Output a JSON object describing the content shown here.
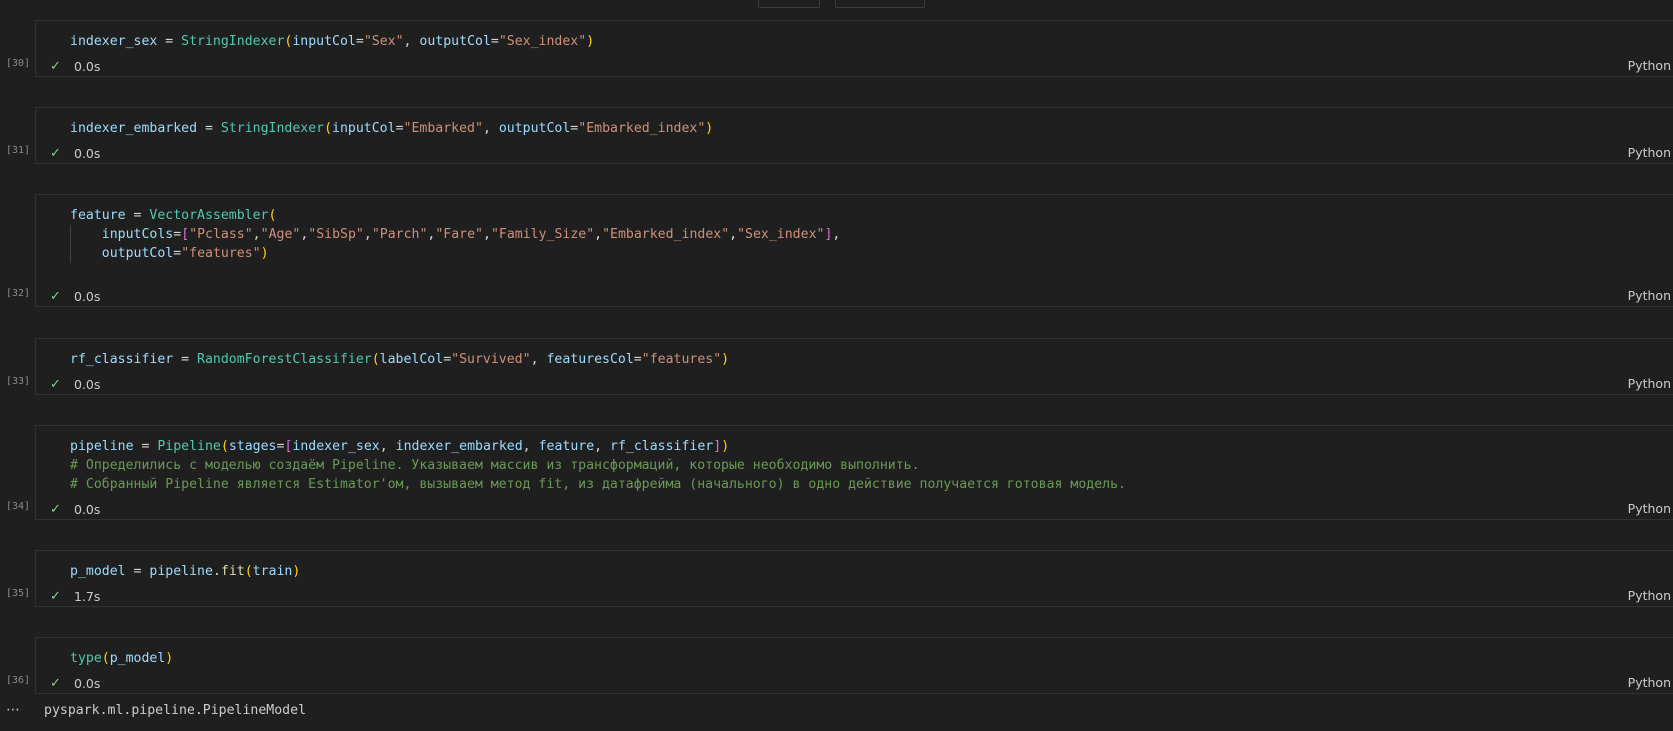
{
  "cells": [
    {
      "exec_count": "[30]",
      "time": "0.0s",
      "language": "Python",
      "lines": [
        [
          [
            "indexer_sex",
            "v"
          ],
          [
            " = ",
            "o"
          ],
          [
            "StringIndexer",
            "c"
          ],
          [
            "(",
            "b1"
          ],
          [
            "inputCol",
            "v"
          ],
          [
            "=",
            "o"
          ],
          [
            "\"Sex\"",
            "s"
          ],
          [
            ", ",
            "o"
          ],
          [
            "outputCol",
            "v"
          ],
          [
            "=",
            "o"
          ],
          [
            "\"Sex_index\"",
            "s"
          ],
          [
            ")",
            "b1"
          ]
        ]
      ]
    },
    {
      "exec_count": "[31]",
      "time": "0.0s",
      "language": "Python",
      "lines": [
        [
          [
            "indexer_embarked",
            "v"
          ],
          [
            " = ",
            "o"
          ],
          [
            "StringIndexer",
            "c"
          ],
          [
            "(",
            "b1"
          ],
          [
            "inputCol",
            "v"
          ],
          [
            "=",
            "o"
          ],
          [
            "\"Embarked\"",
            "s"
          ],
          [
            ", ",
            "o"
          ],
          [
            "outputCol",
            "v"
          ],
          [
            "=",
            "o"
          ],
          [
            "\"Embarked_index\"",
            "s"
          ],
          [
            ")",
            "b1"
          ]
        ]
      ]
    },
    {
      "exec_count": "[32]",
      "time": "0.0s",
      "language": "Python",
      "lines": [
        [
          [
            "feature",
            "v"
          ],
          [
            " = ",
            "o"
          ],
          [
            "VectorAssembler",
            "c"
          ],
          [
            "(",
            "b1"
          ]
        ],
        [
          [
            "    ",
            "o"
          ],
          [
            "inputCols",
            "v"
          ],
          [
            "=",
            "o"
          ],
          [
            "[",
            "b2"
          ],
          [
            "\"Pclass\"",
            "s"
          ],
          [
            ",",
            "o"
          ],
          [
            "\"Age\"",
            "s"
          ],
          [
            ",",
            "o"
          ],
          [
            "\"SibSp\"",
            "s"
          ],
          [
            ",",
            "o"
          ],
          [
            "\"Parch\"",
            "s"
          ],
          [
            ",",
            "o"
          ],
          [
            "\"Fare\"",
            "s"
          ],
          [
            ",",
            "o"
          ],
          [
            "\"Family_Size\"",
            "s"
          ],
          [
            ",",
            "o"
          ],
          [
            "\"Embarked_index\"",
            "s"
          ],
          [
            ",",
            "o"
          ],
          [
            "\"Sex_index\"",
            "s"
          ],
          [
            "]",
            "b2"
          ],
          [
            ",",
            "o"
          ]
        ],
        [
          [
            "    ",
            "o"
          ],
          [
            "outputCol",
            "v"
          ],
          [
            "=",
            "o"
          ],
          [
            "\"features\"",
            "s"
          ],
          [
            ")",
            "b1"
          ]
        ]
      ]
    },
    {
      "exec_count": "[33]",
      "time": "0.0s",
      "language": "Python",
      "lines": [
        [
          [
            "rf_classifier",
            "v"
          ],
          [
            " = ",
            "o"
          ],
          [
            "RandomForestClassifier",
            "c"
          ],
          [
            "(",
            "b1"
          ],
          [
            "labelCol",
            "v"
          ],
          [
            "=",
            "o"
          ],
          [
            "\"Survived\"",
            "s"
          ],
          [
            ", ",
            "o"
          ],
          [
            "featuresCol",
            "v"
          ],
          [
            "=",
            "o"
          ],
          [
            "\"features\"",
            "s"
          ],
          [
            ")",
            "b1"
          ]
        ]
      ]
    },
    {
      "exec_count": "[34]",
      "time": "0.0s",
      "language": "Python",
      "lines": [
        [
          [
            "pipeline",
            "v"
          ],
          [
            " = ",
            "o"
          ],
          [
            "Pipeline",
            "c"
          ],
          [
            "(",
            "b1"
          ],
          [
            "stages",
            "v"
          ],
          [
            "=",
            "o"
          ],
          [
            "[",
            "b2"
          ],
          [
            "indexer_sex",
            "v"
          ],
          [
            ", ",
            "o"
          ],
          [
            "indexer_embarked",
            "v"
          ],
          [
            ", ",
            "o"
          ],
          [
            "feature",
            "v"
          ],
          [
            ", ",
            "o"
          ],
          [
            "rf_classifier",
            "v"
          ],
          [
            "]",
            "b2"
          ],
          [
            ")",
            "b1"
          ]
        ],
        [
          [
            "# Определились с моделью создаём Pipeline. Указываем массив из трансформаций, которые необходимо выполнить.",
            "m"
          ]
        ],
        [
          [
            "# Собранный Pipeline является Estimator'ом, вызываем метод fit, из датафрейма (начального) в одно действие получается готовая модель.",
            "m"
          ]
        ]
      ]
    },
    {
      "exec_count": "[35]",
      "time": "1.7s",
      "language": "Python",
      "lines": [
        [
          [
            "p_model",
            "v"
          ],
          [
            " = ",
            "o"
          ],
          [
            "pipeline",
            "v"
          ],
          [
            ".",
            "o"
          ],
          [
            "fit",
            "f"
          ],
          [
            "(",
            "b1"
          ],
          [
            "train",
            "v"
          ],
          [
            ")",
            "b1"
          ]
        ]
      ]
    },
    {
      "exec_count": "[36]",
      "time": "0.0s",
      "language": "Python",
      "lines": [
        [
          [
            "type",
            "c"
          ],
          [
            "(",
            "b1"
          ],
          [
            "p_model",
            "v"
          ],
          [
            ")",
            "b1"
          ]
        ]
      ]
    }
  ],
  "output": {
    "dots": "⋯",
    "text": "pyspark.ml.pipeline.PipelineModel"
  },
  "icons": {
    "check": "check-icon",
    "more": "ellipsis-icon"
  },
  "colors": {
    "background": "#1f1f1f",
    "check": "#89d185",
    "string": "#ce9178",
    "class": "#4ec9b0",
    "variable": "#9cdcfe",
    "comment": "#6a9955"
  }
}
